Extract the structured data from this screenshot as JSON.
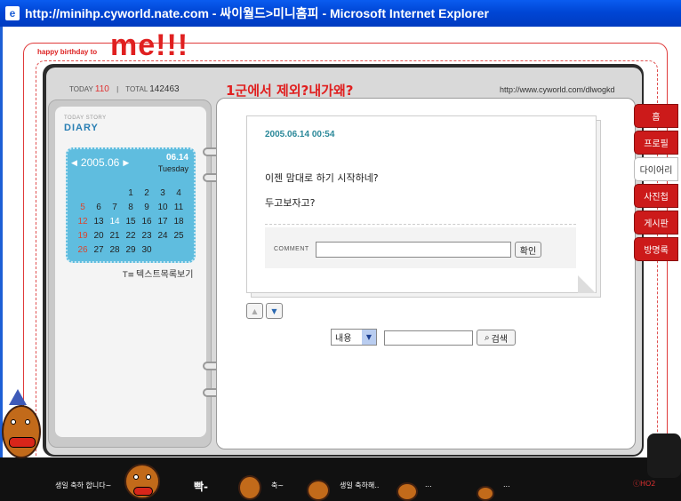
{
  "window": {
    "title": "http://minihp.cyworld.nate.com - 싸이월드>미니홈피 - Microsoft Internet Explorer",
    "icon": "ie-icon"
  },
  "banner": {
    "small_text": "happy birthday to",
    "big_text": "me!!!"
  },
  "counter": {
    "today_label": "TODAY",
    "today_value": "110",
    "separator": "|",
    "total_label": "TOTAL",
    "total_value": "142463"
  },
  "header": {
    "title": "1군에서 제외?내가왜?",
    "url": "http://www.cyworld.com/dlwogkd"
  },
  "left": {
    "today_story": "TODAY STORY",
    "section_label": "DIARY",
    "calendar": {
      "month": "2005.06",
      "date": "06.14",
      "weekday": "Tuesday",
      "days": [
        "",
        "",
        "",
        "1",
        "2",
        "3",
        "4",
        "5",
        "6",
        "7",
        "8",
        "9",
        "10",
        "11",
        "12",
        "13",
        "14",
        "15",
        "16",
        "17",
        "18",
        "19",
        "20",
        "21",
        "22",
        "23",
        "24",
        "25",
        "26",
        "27",
        "28",
        "29",
        "30",
        "",
        ""
      ]
    },
    "text_list_link": "텍스트목록보기"
  },
  "post": {
    "date": "2005.06.14 00:54",
    "line1": "이젠 맘대로 하기 시작하네?",
    "line2": "두고보자고?",
    "comment_label": "COMMENT",
    "comment_value": "",
    "confirm_label": "확인"
  },
  "search": {
    "select_value": "내용",
    "input_value": "",
    "button_label": "검색"
  },
  "tabs": [
    {
      "label": "홈",
      "active": false
    },
    {
      "label": "프로필",
      "active": false
    },
    {
      "label": "다이어리",
      "active": true
    },
    {
      "label": "사진첩",
      "active": false
    },
    {
      "label": "게시판",
      "active": false
    },
    {
      "label": "방명록",
      "active": false
    }
  ],
  "band": {
    "text1": "생일 축하 합니다~",
    "text2": "빡-",
    "text3": "축~",
    "text4": "생일 축하해..",
    "text5": "...",
    "text6": "...",
    "logo": "ⓒHO2"
  },
  "colors": {
    "accent_red": "#e02020",
    "calendar_blue": "#5fbddf",
    "titlebar_blue": "#0046d5"
  }
}
